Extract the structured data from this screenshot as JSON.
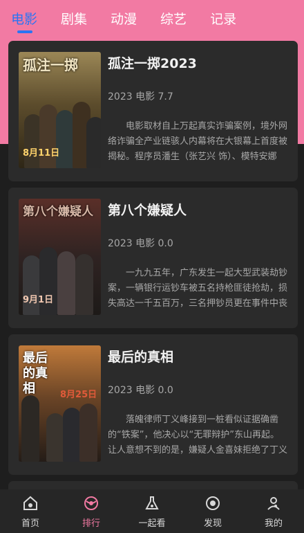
{
  "tabs": [
    "电影",
    "剧集",
    "动漫",
    "综艺",
    "记录"
  ],
  "active_tab": "电影",
  "movies": [
    {
      "title": "孤注一掷2023",
      "meta": "2023 电影 7.7",
      "desc": "电影取材自上万起真实诈骗案例，境外网络诈骗全产业链骇人内幕将在大银幕上首度被揭秘。程序员潘生（张艺兴 饰）、模特安娜（金晨 饰）被海外…",
      "poster_title": "孤注一掷",
      "poster_date": "8月11日",
      "poster_color": "#6b5a38"
    },
    {
      "title": "第八个嫌疑人",
      "meta": "2023 电影 0.0",
      "desc": "一九九五年，广东发生一起大型武装劫钞案，一辆银行运钞车被五名持枪匪徒抢劫，损失高达一千五百万，三名押钞员更在事件中丧生。事件震惊全…",
      "poster_title": "第八个嫌疑人",
      "poster_date": "9月1日",
      "poster_color": "#4a2a26"
    },
    {
      "title": "最后的真相",
      "meta": "2023 电影 0.0",
      "desc": "落魄律师丁义峰接到一桩看似证据确凿的“铁案”，他决心以“无罪辩护”东山再起。让人意想不到的是，嫌疑人金喜妹拒绝了丁义峰，竟一心求死。眼见…",
      "poster_title": "最后的真相",
      "poster_date": "8月25日",
      "poster_color": "#7a4a22"
    }
  ],
  "nav": [
    {
      "label": "首页",
      "icon": "home-icon"
    },
    {
      "label": "排行",
      "icon": "ranking-icon"
    },
    {
      "label": "一起看",
      "icon": "watch-together-icon"
    },
    {
      "label": "发现",
      "icon": "discover-icon"
    },
    {
      "label": "我的",
      "icon": "profile-icon"
    }
  ],
  "active_nav": "排行",
  "colors": {
    "accent_blue": "#2b74f3",
    "accent_pink": "#f27aa3",
    "card": "#2b2b2b",
    "background": "#1e1e1e"
  }
}
